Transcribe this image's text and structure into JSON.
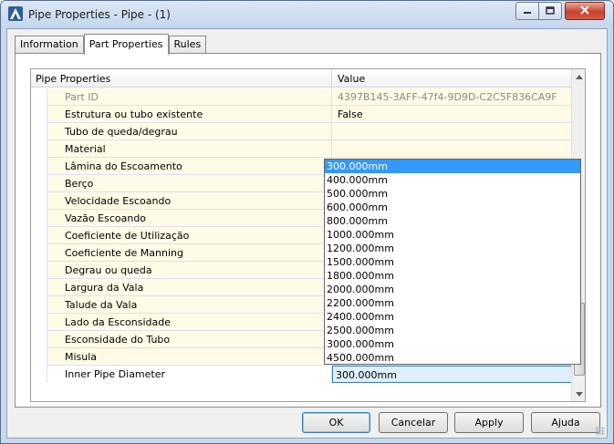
{
  "window": {
    "title": "Pipe Properties - Pipe - (1)"
  },
  "tabs": [
    {
      "label": "Information"
    },
    {
      "label": "Part Properties"
    },
    {
      "label": "Rules"
    }
  ],
  "grid": {
    "header": {
      "name": "Pipe Properties",
      "value": "Value"
    },
    "rows": [
      {
        "name": "Part ID",
        "value": "4397B145-3AFF-47f4-9D9D-C2C5F836CA9F"
      },
      {
        "name": "Estrutura ou tubo existente",
        "value": "False"
      },
      {
        "name": "Tubo de queda/degrau",
        "value": ""
      },
      {
        "name": "Material",
        "value": ""
      },
      {
        "name": "Lâmina do Escoamento",
        "value": ""
      },
      {
        "name": "Berço",
        "value": ""
      },
      {
        "name": "Velocidade Escoando",
        "value": ""
      },
      {
        "name": "Vazão Escoando",
        "value": ""
      },
      {
        "name": "Coeficiente de Utilização",
        "value": ""
      },
      {
        "name": "Coeficiente de Manning",
        "value": ""
      },
      {
        "name": "Degrau ou queda",
        "value": ""
      },
      {
        "name": "Largura da Vala",
        "value": ""
      },
      {
        "name": "Talude da Vala",
        "value": ""
      },
      {
        "name": "Lado da Esconsidade",
        "value": ""
      },
      {
        "name": "Esconsidade do Tubo",
        "value": ""
      },
      {
        "name": "Misula",
        "value": ""
      },
      {
        "name": "Inner Pipe Diameter",
        "value": "300.000mm"
      }
    ]
  },
  "dropdown": {
    "selected": "300.000mm",
    "options": [
      "300.000mm",
      "400.000mm",
      "500.000mm",
      "600.000mm",
      "800.000mm",
      "1000.000mm",
      "1200.000mm",
      "1500.000mm",
      "1800.000mm",
      "2000.000mm",
      "2200.000mm",
      "2400.000mm",
      "2500.000mm",
      "3000.000mm",
      "4500.000mm"
    ]
  },
  "buttons": {
    "ok": "OK",
    "cancel": "Cancelar",
    "apply": "Apply",
    "help": "Ajuda"
  },
  "colors": {
    "row_background": "#fffbe6",
    "highlight": "#3399ff"
  }
}
